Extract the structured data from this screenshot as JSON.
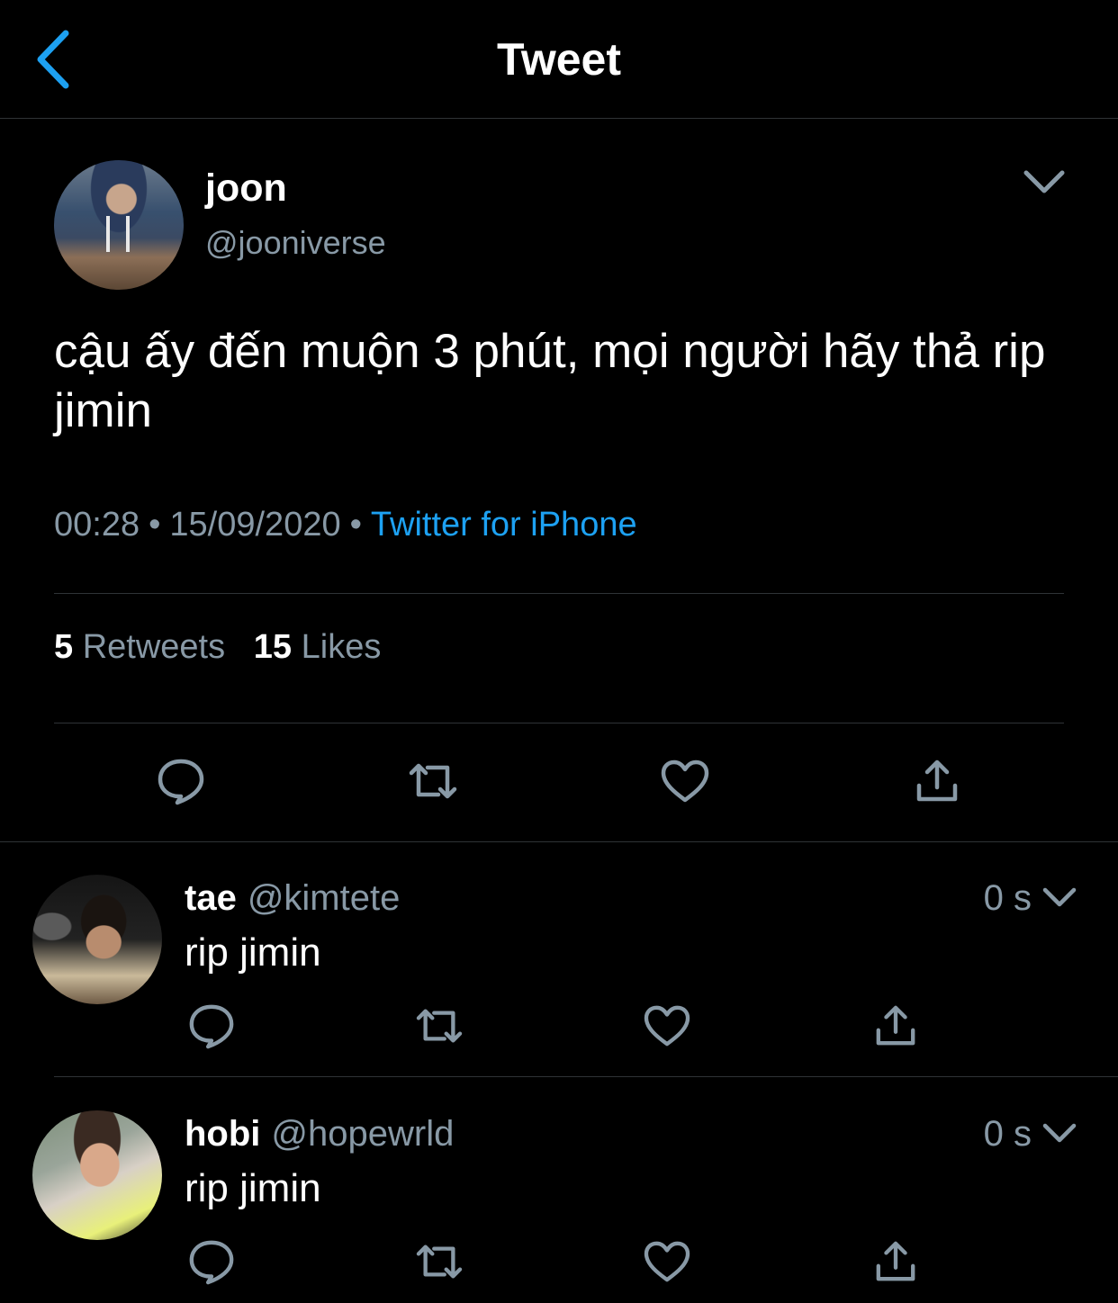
{
  "header": {
    "title": "Tweet",
    "back_icon": "chevron-left-icon"
  },
  "colors": {
    "background": "#000000",
    "accent": "#1da1f2",
    "secondary_text": "#8899a6",
    "divider": "#2f3336"
  },
  "tweet": {
    "author_name": "joon",
    "author_handle": "@jooniverse",
    "text": "cậu ấy đến muộn 3 phút, mọi người hãy thả rip jimin",
    "time": "00:28",
    "date": "15/09/2020",
    "separator": "•",
    "source": "Twitter for iPhone",
    "retweet_count": "5",
    "retweet_label": "Retweets",
    "like_count": "15",
    "like_label": "Likes",
    "actions": [
      "reply-icon",
      "retweet-icon",
      "like-icon",
      "share-icon"
    ]
  },
  "replies": [
    {
      "name": "tae",
      "handle": "@kimtete",
      "time": "0 s",
      "text": "rip jimin"
    },
    {
      "name": "hobi",
      "handle": "@hopewrld",
      "time": "0 s",
      "text": "rip jimin"
    }
  ]
}
